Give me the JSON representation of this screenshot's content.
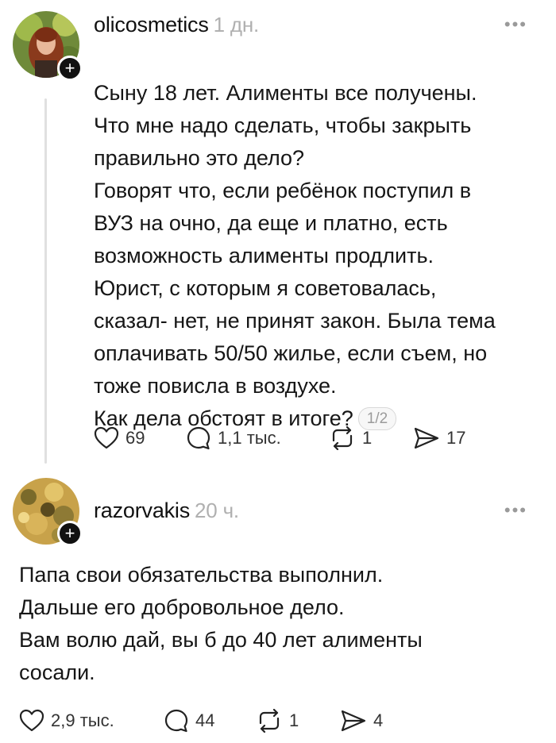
{
  "posts": [
    {
      "username": "olicosmetics",
      "time": "1 дн.",
      "more": "•••",
      "text": "Сыну 18 лет. Алименты все получены.\nЧто мне надо сделать, чтобы закрыть\nправильно это дело?\nГоворят что, если ребёнок поступил в\nВУЗ на очно, да еще и платно, есть\nвозможность алименты продлить.\nЮрист, с которым я советовалась,\nсказал- нет, не принят закон. Была тема\nоплачивать 50/50 жилье, если съем, но\nтоже повисла в воздухе.",
      "last_line": "Как дела обстоят в итоге?",
      "page": "1/2",
      "likes": "69",
      "replies": "1,1 тыс.",
      "reposts": "1",
      "shares": "17",
      "follow": "+"
    },
    {
      "username": "razorvakis",
      "time": "20 ч.",
      "more": "•••",
      "text": "Папа свои обязательства выполнил.\nДальше его добровольное дело.\nВам волю дай, вы б до 40 лет алименты\nсосали.",
      "likes": "2,9 тыс.",
      "replies": "44",
      "reposts": "1",
      "shares": "4",
      "follow": "+"
    }
  ],
  "icons": {
    "like": "heart-icon",
    "reply": "comment-icon",
    "repost": "repost-icon",
    "share": "send-icon",
    "more": "more-icon"
  },
  "colors": {
    "text": "#161616",
    "muted": "#b0b0b0",
    "thread_line": "#e0e0e0"
  }
}
